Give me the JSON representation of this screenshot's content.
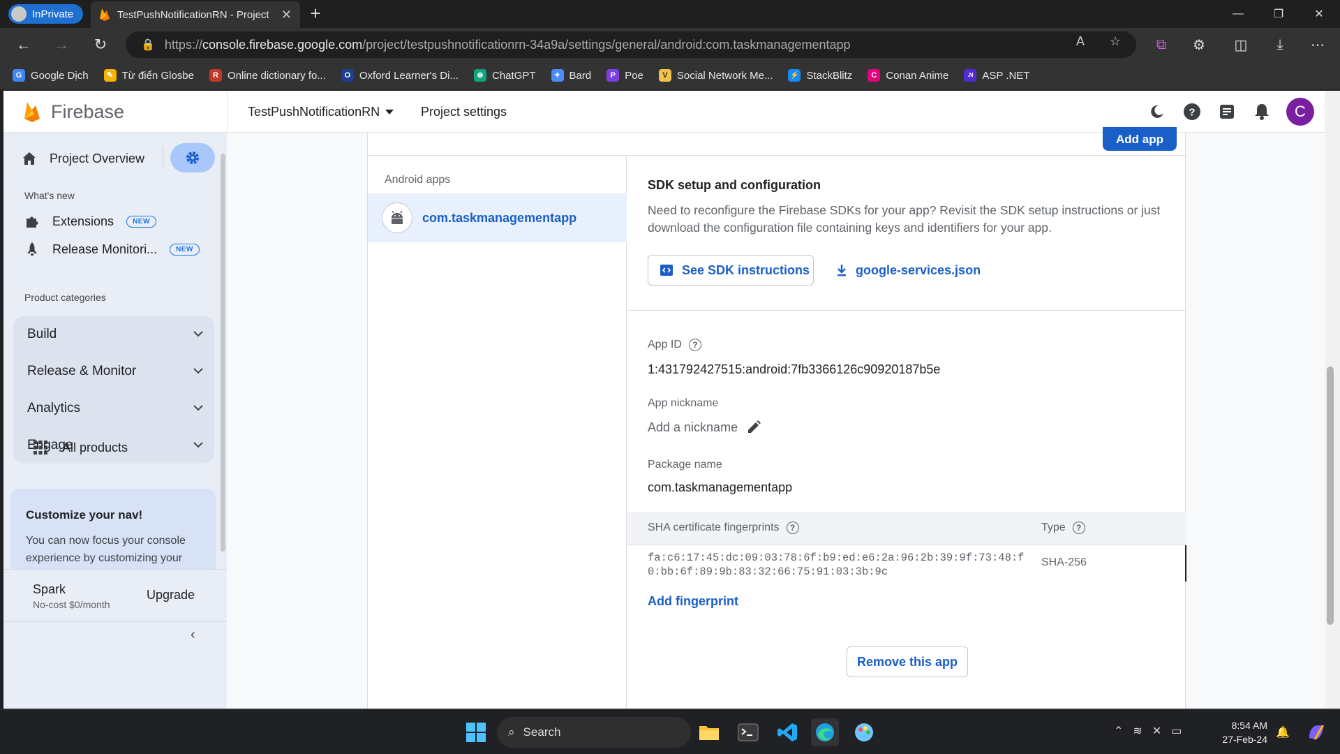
{
  "browser": {
    "inprivate_label": "InPrivate",
    "tab_title": "TestPushNotificationRN - Project",
    "url_scheme": "https://",
    "url_host": "console.firebase.google.com",
    "url_path": "/project/testpushnotificationrn-34a9a/settings/general/android:com.taskmanagementapp",
    "bookmarks": [
      {
        "label": "Google Dịch",
        "color": "#4285f4",
        "glyph": "G"
      },
      {
        "label": "Từ điển Glosbe",
        "color": "#f4b400",
        "glyph": "✎"
      },
      {
        "label": "Online dictionary fo...",
        "color": "#c0392b",
        "glyph": "R"
      },
      {
        "label": "Oxford Learner's Di...",
        "color": "#1d3f8f",
        "glyph": "O"
      },
      {
        "label": "ChatGPT",
        "color": "#10a37f",
        "glyph": "⊛"
      },
      {
        "label": "Bard",
        "color": "#4c8bf5",
        "glyph": "✦"
      },
      {
        "label": "Poe",
        "color": "#7b3fe4",
        "glyph": "P"
      },
      {
        "label": "Social Network Me...",
        "color": "#f0c14b",
        "glyph": "V"
      },
      {
        "label": "StackBlitz",
        "color": "#1389fd",
        "glyph": "⚡"
      },
      {
        "label": "Conan Anime",
        "color": "#e4007f",
        "glyph": "C"
      },
      {
        "label": "ASP .NET",
        "color": "#512bd4",
        "glyph": ".N"
      }
    ]
  },
  "header": {
    "brand": "Firebase",
    "project_name": "TestPushNotificationRN",
    "page": "Project settings",
    "avatar_letter": "C"
  },
  "sidebar": {
    "overview": "Project Overview",
    "whats_new": "What's new",
    "new_items": [
      {
        "label": "Extensions",
        "badge": "NEW"
      },
      {
        "label": "Release Monitori...",
        "badge": "NEW"
      }
    ],
    "categories_title": "Product categories",
    "categories": [
      "Build",
      "Release & Monitor",
      "Analytics",
      "Engage"
    ],
    "all_products": "All products",
    "customize_title": "Customize your nav!",
    "customize_text": "You can now focus your console experience by customizing your",
    "plan_name": "Spark",
    "plan_sub": "No-cost $0/month",
    "upgrade": "Upgrade"
  },
  "main": {
    "add_app": "Add app",
    "apps_label": "Android apps",
    "app_package": "com.taskmanagementapp",
    "sdk_title": "SDK setup and configuration",
    "sdk_text": "Need to reconfigure the Firebase SDKs for your app? Revisit the SDK setup instructions or just download the configuration file containing keys and identifiers for your app.",
    "sdk_button": "See SDK instructions",
    "config_file": "google-services.json",
    "app_id_label": "App ID",
    "app_id": "1:431792427515:android:7fb3366126c90920187b5e",
    "nickname_label": "App nickname",
    "nickname_placeholder": "Add a nickname",
    "package_label": "Package name",
    "package_name": "com.taskmanagementapp",
    "sha_header": "SHA certificate fingerprints",
    "type_header": "Type",
    "fingerprint": "fa:c6:17:45:dc:09:03:78:6f:b9:ed:e6:2a:96:2b:39:9f:73:48:f0:bb:6f:89:9b:83:32:66:75:91:03:3b:9c",
    "fingerprint_type": "SHA-256",
    "add_fingerprint": "Add fingerprint",
    "remove_app": "Remove this app"
  },
  "taskbar": {
    "search": "Search",
    "time": "8:54 AM",
    "date": "27-Feb-24"
  }
}
